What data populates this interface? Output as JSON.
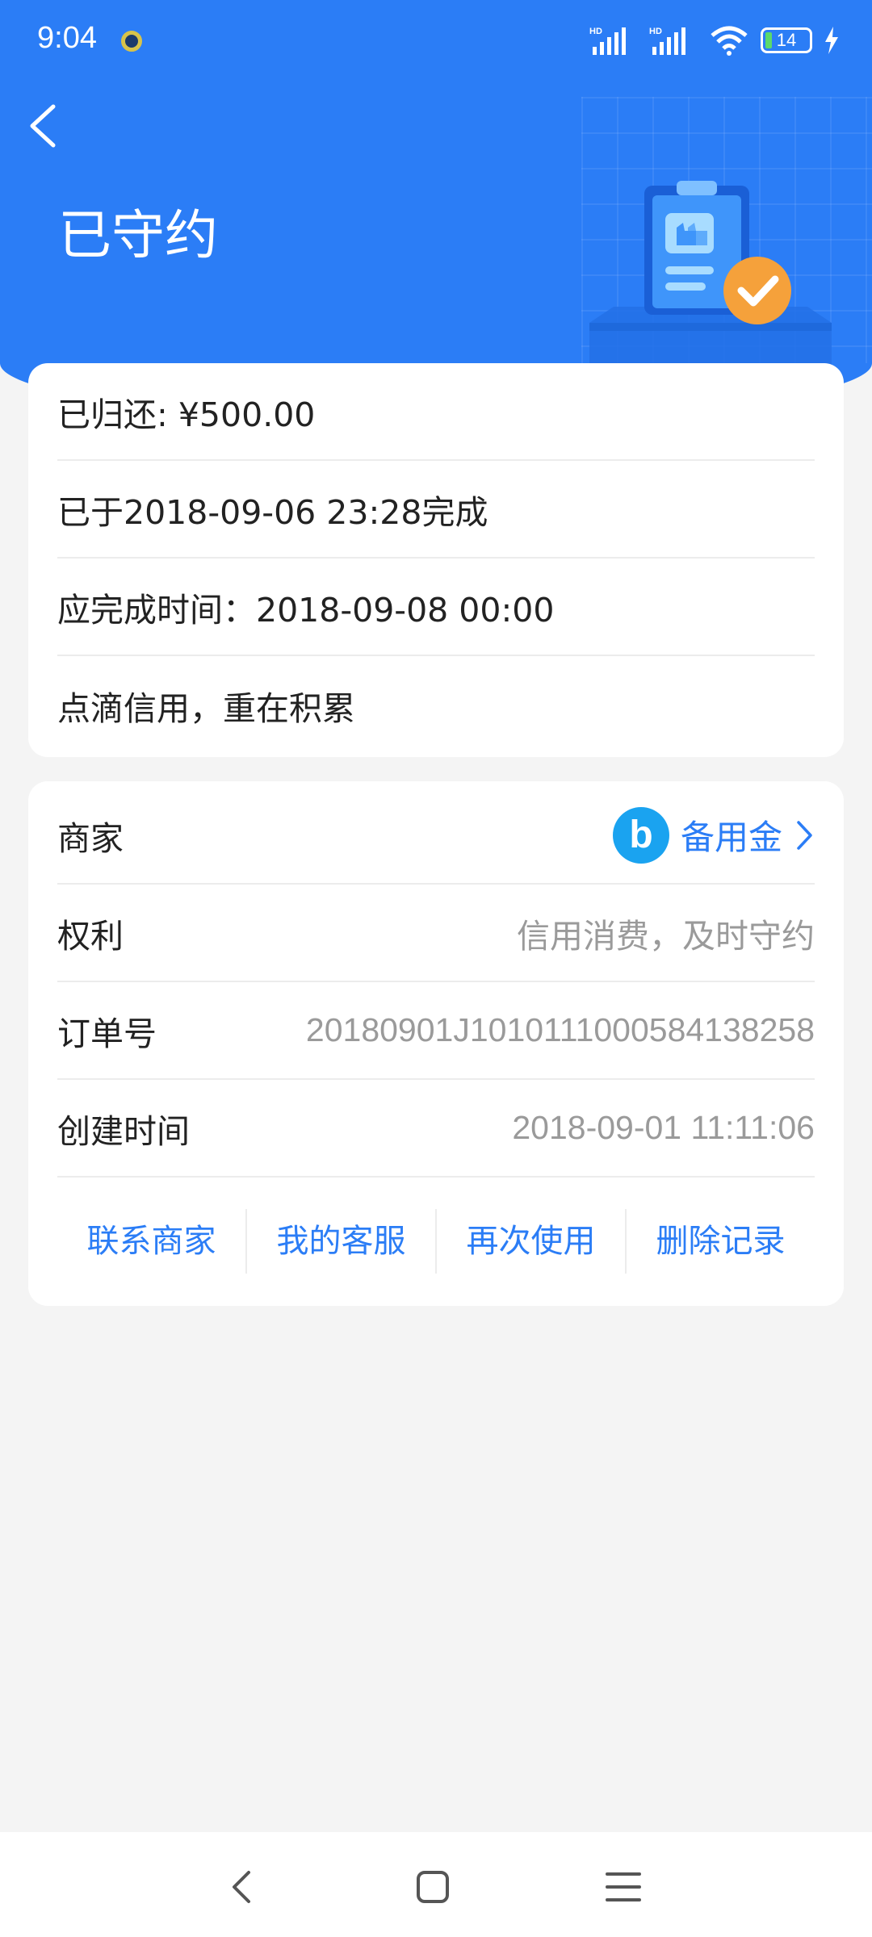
{
  "status_bar": {
    "time": "9:04",
    "battery": "14",
    "icons": [
      "hd-signal-icon",
      "hd-signal-icon",
      "wifi-icon",
      "battery-icon",
      "charging-icon"
    ]
  },
  "header": {
    "title": "已守约",
    "back_icon": "chevron-left-icon"
  },
  "summary": {
    "returned": "已归还: ¥500.00",
    "completed": "已于2018-09-06 23:28完成",
    "due": "应完成时间：2018-09-08 00:00",
    "slogan": "点滴信用，重在积累"
  },
  "details": {
    "merchant_label": "商家",
    "merchant_name": "备用金",
    "merchant_logo_letter": "b",
    "rights_label": "权利",
    "rights_value": "信用消费，及时守约",
    "order_label": "订单号",
    "order_value": "20180901J101011100058413825​8",
    "created_label": "创建时间",
    "created_value": "2018-09-01 11:11:06"
  },
  "actions": {
    "contact": "联系商家",
    "service": "我的客服",
    "reuse": "再次使用",
    "delete": "删除记录"
  },
  "colors": {
    "primary": "#2b7df6",
    "merchant_logo": "#1aa3f0",
    "check_badge": "#f5a13b"
  }
}
